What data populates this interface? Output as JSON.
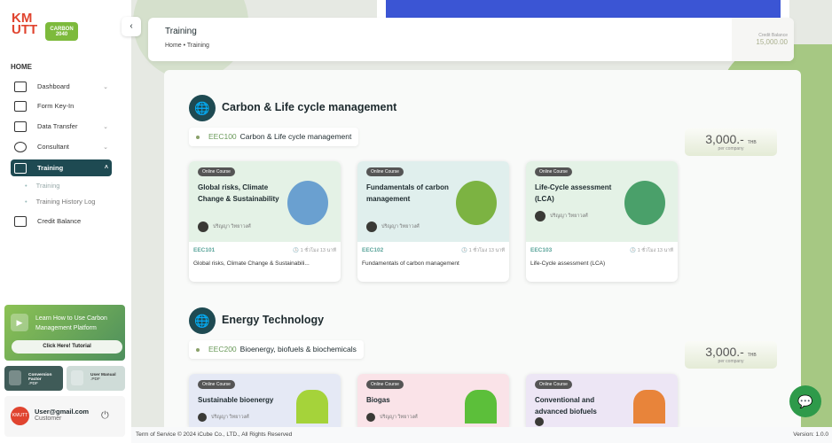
{
  "sidebar": {
    "logo": "KMUTT",
    "logo2": "CARBON 2040",
    "home": "HOME",
    "items": [
      {
        "label": "Dashboard"
      },
      {
        "label": "Form Key-In"
      },
      {
        "label": "Data Transfer"
      },
      {
        "label": "Consultant"
      },
      {
        "label": "Training"
      },
      {
        "label": "Credit Balance"
      }
    ],
    "subitems": [
      {
        "label": "Training"
      },
      {
        "label": "Training History Log"
      }
    ],
    "tutorial": {
      "title": "Learn How to Use Carbon Management Platform",
      "button": "Click Here! Tutorial"
    },
    "conversion": {
      "label": "Conversion Factor",
      "ext": ".PDF"
    },
    "manual": {
      "label": "User Manual",
      "ext": ".PDF"
    },
    "user": {
      "email": "User@gmail.com",
      "role": "Customer"
    }
  },
  "header": {
    "title": "Training",
    "breadcrumb": [
      "Home",
      "Training"
    ],
    "credit_label": "Credit Balance",
    "credit_value": "15,000.00"
  },
  "sections": [
    {
      "title": "Carbon & Life cycle management",
      "tag_code": "EEC100",
      "tag_label": "Carbon & Life cycle management",
      "price": "3,000.-",
      "currency": "THB",
      "per": "per company",
      "cards": [
        {
          "badge": "Online Course",
          "title": "Global risks, Climate Change & Sustainability",
          "author": "ปริญญา วิทยาวงศ์",
          "code": "EEC101",
          "duration": "1 ชั่วโมง 13 นาที",
          "desc": "Global risks, Climate Change & Sustainabili..."
        },
        {
          "badge": "Online Course",
          "title": "Fundamentals of carbon management",
          "author": "ปริญญา วิทยาวงศ์",
          "code": "EEC102",
          "duration": "1 ชั่วโมง 13 นาที",
          "desc": "Fundamentals of carbon management"
        },
        {
          "badge": "Online Course",
          "title": "Life-Cycle assessment (LCA)",
          "author": "ปริญญา วิทยาวงศ์",
          "code": "EEC103",
          "duration": "1 ชั่วโมง 13 นาที",
          "desc": "Life-Cycle assessment (LCA)"
        }
      ]
    },
    {
      "title": "Energy Technology",
      "tag_code": "EEC200",
      "tag_label": "Bioenergy, biofuels & biochemicals",
      "price": "3,000.-",
      "currency": "THB",
      "per": "per company",
      "cards": [
        {
          "badge": "Online Course",
          "title": "Sustainable bioenergy",
          "author": "ปริญญา วิทยาวงศ์"
        },
        {
          "badge": "Online Course",
          "title": "Biogas",
          "author": "ปริญญา วิทยาวงศ์"
        },
        {
          "badge": "Online Course",
          "title": "Conventional and advanced biofuels",
          "author": ""
        }
      ]
    }
  ],
  "footer": {
    "copyright": "Term of Service © 2024 iCube Co., LTD., All Rights Reserved",
    "version": "Version: 1.0.0"
  }
}
